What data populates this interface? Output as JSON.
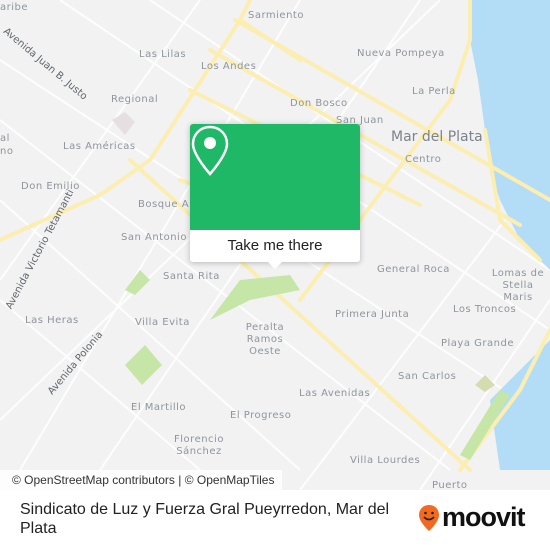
{
  "map": {
    "water_color": "#b3dcf7",
    "road_color": "#fbeeb0",
    "park_color": "#c5e6a6",
    "city_label": "Mar del Plata",
    "neighborhoods": [
      "aribe",
      "Sarmiento",
      "Las Lilas",
      "Los Andes",
      "Nueva Pompeya",
      "La Perla",
      "Regional",
      "Don Bosco",
      "San Juan",
      "Centro",
      "Las Américas",
      "Don Emilio",
      "Bosque A",
      "San Antonio",
      "Santa Rita",
      "General Roca",
      "Lomas de Stella Maris",
      "Los Troncos",
      "Primera Junta",
      "Peralta Ramos Oeste",
      "Las Heras",
      "Villa Evita",
      "Playa Grande",
      "San Carlos",
      "Las Avenidas",
      "El Martillo",
      "El Progreso",
      "Florencio Sánchez",
      "Villa Lourdes",
      "Puerto",
      "al",
      "no"
    ],
    "streets": [
      "Avenida Juan B. Justo",
      "Avenida Victorio Tetamanti",
      "Avenida Polonia"
    ]
  },
  "popup": {
    "icon": "map-pin-icon",
    "button_label": "Take me there",
    "color": "#1fb866"
  },
  "attribution": "© OpenStreetMap contributors | © OpenMapTiles",
  "footer": {
    "title": "Sindicato de Luz y Fuerza Gral Pueyrredon, Mar del Plata",
    "logo_text": "moovit",
    "logo_color": "#f26a1f"
  }
}
